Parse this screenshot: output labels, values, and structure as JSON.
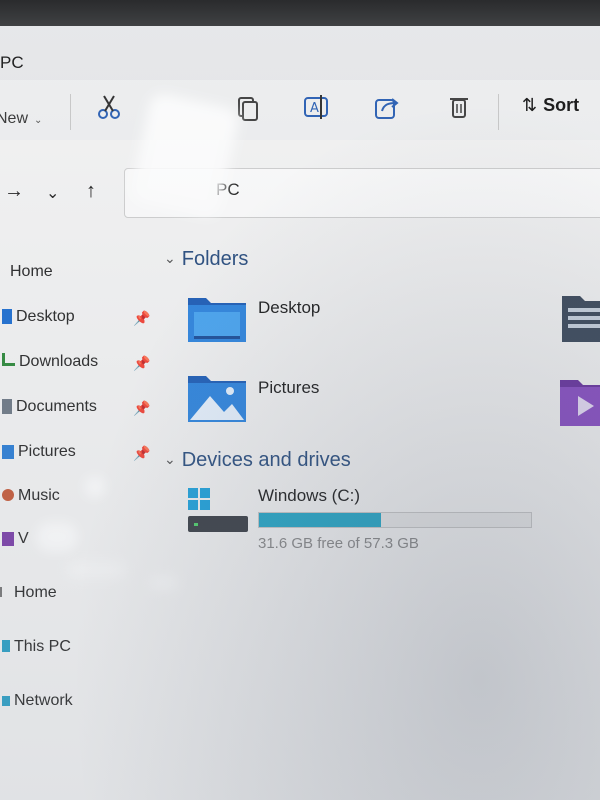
{
  "window": {
    "title": "PC"
  },
  "toolbar": {
    "new_label": "New",
    "new_chevron": "⌄",
    "icons": [
      "cut-icon",
      "copy-icon",
      "rename-icon",
      "share-icon",
      "delete-icon"
    ],
    "sort_label": "Sort",
    "sort_arrows": "⇅"
  },
  "address": {
    "back": "←",
    "forward": "→",
    "recent": "⌄",
    "up": "↑",
    "path": "PC"
  },
  "sidebar": {
    "items": [
      {
        "label": "Home",
        "icon": "home-icon",
        "pinned": false
      },
      {
        "label": "Desktop",
        "icon": "desktop-folder-icon",
        "pinned": true
      },
      {
        "label": "Downloads",
        "icon": "download-icon",
        "pinned": true
      },
      {
        "label": "Documents",
        "icon": "documents-icon",
        "pinned": true
      },
      {
        "label": "Pictures",
        "icon": "pictures-icon",
        "pinned": true
      },
      {
        "label": "Music",
        "icon": "music-icon",
        "pinned": false
      },
      {
        "label": "V",
        "icon": "videos-icon",
        "pinned": false
      },
      {
        "label": "Home",
        "icon": "home-icon",
        "pinned": false
      },
      {
        "label": "This PC",
        "icon": "pc-icon",
        "pinned": false
      },
      {
        "label": "Network",
        "icon": "network-icon",
        "pinned": false
      }
    ],
    "pin_glyph": "📌"
  },
  "main": {
    "folders_heading": "Folders",
    "caret": "⌄",
    "folders": [
      {
        "label": "Desktop",
        "icon": "desktop-folder-icon"
      },
      {
        "label": "Pictures",
        "icon": "pictures-folder-icon"
      }
    ],
    "devices_heading": "Devices and drives",
    "drive": {
      "label": "Windows (C:)",
      "free_text": "31.6 GB free of 57.3 GB",
      "used_fraction": 0.45,
      "fill_color": "#26a8c8"
    }
  },
  "colors": {
    "accent": "#26a8c8",
    "folder_blue": "#1f6fd1",
    "heading": "#2b4f80"
  }
}
